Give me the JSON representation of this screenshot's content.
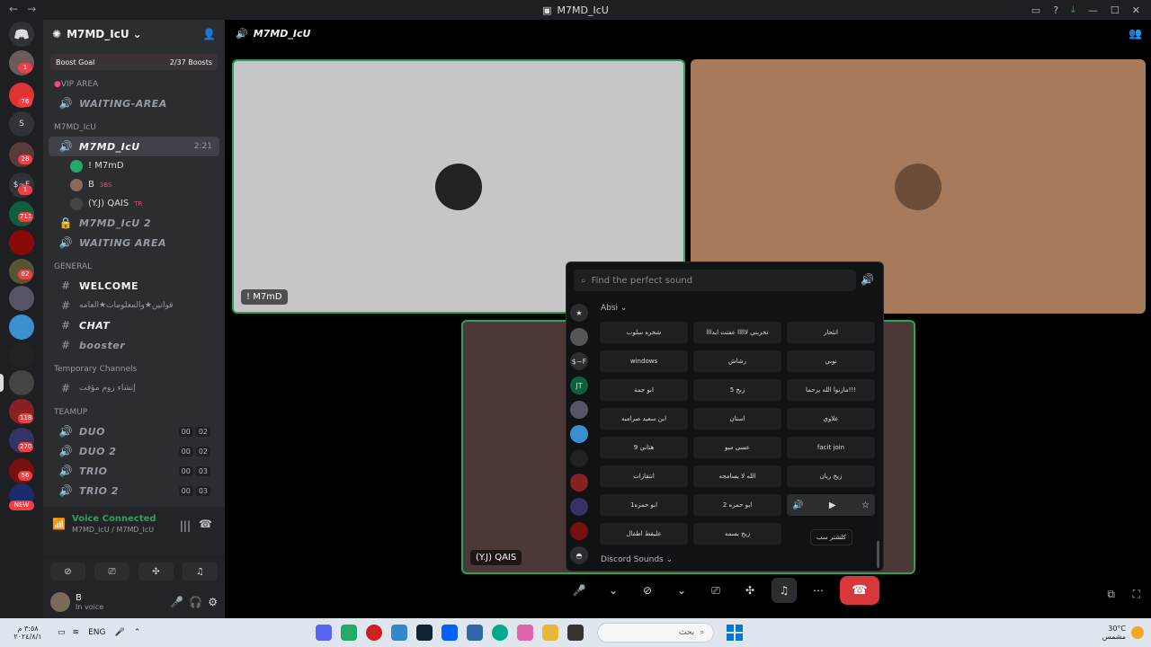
{
  "window": {
    "title": "M7MD_IcU"
  },
  "guild_badges": [
    "1",
    "76",
    "28",
    "1",
    "711",
    "62",
    "118",
    "270",
    "56",
    "NEW"
  ],
  "guild_labels": {
    "s": "S",
    "sf": "$~F"
  },
  "server": {
    "name": "M7MD_IcU",
    "boost_goal": "Boost Goal",
    "boost_count": "2/37 Boosts",
    "categories": {
      "vip": "VIP AREA",
      "m7md": "M7MD_IcU",
      "general": "GENERAL",
      "temp": "Temporary Channels",
      "teamup": "TEAMUP"
    },
    "channels": {
      "waiting1": "WAITING-AREA",
      "m7md_active": "M7MD_IcU",
      "m7md_time": "2:21",
      "m7md2": "M7MD_IcU 2",
      "waiting2": "WAITING AREA",
      "welcome": "WELCOME",
      "rules": "قوانين★والمعلومات★العامه",
      "chat": "CHAT",
      "booster": "booster",
      "create_room": "إنشاء روم مؤقت",
      "duo": "DUO",
      "duo2": "DUO 2",
      "trio": "TRIO",
      "trio2": "TRIO 2",
      "duo_cnt": [
        "00",
        "02"
      ],
      "duo2_cnt": [
        "00",
        "02"
      ],
      "trio_cnt": [
        "00",
        "03"
      ],
      "trio2_cnt": [
        "00",
        "03"
      ]
    },
    "voice_users": [
      "! M7mD",
      "B",
      "(Y.J) QAIS"
    ],
    "user_tags": [
      "3BS",
      "TR"
    ]
  },
  "voice": {
    "status": "Voice Connected",
    "location": "M7MD_IcU / M7MD_IcU"
  },
  "panel": {
    "name": "B",
    "status": "In voice"
  },
  "call": {
    "header": "M7MD_IcU",
    "tiles": [
      "! M7mD",
      "",
      "(Y.J) QAIS"
    ]
  },
  "soundboard": {
    "placeholder": "Find the perfect sound",
    "section": "Absi",
    "footer": "Discord Sounds",
    "rail_labels": [
      "$~F",
      "JT"
    ],
    "sounds": [
      "شخره سلوب",
      "تخربني لااااا عفتت ابدااا",
      "انثحار",
      "windows",
      "رشاش",
      "نوبي",
      "ابو جمة",
      "زبخ 5",
      "مازنوا الله يرحما!!!",
      "ابن سعيد صرامبه",
      "استان",
      "علاوي",
      "هتاني 9",
      "عسى ميو",
      "facit join",
      "انتقازات",
      "الله لا يسامحه",
      "زيخ ريان",
      "ابو حمزه1",
      "ابو حمزه 2",
      "",
      "عليقط اطفال",
      "زيخ بسمه",
      "كلشتر سب"
    ],
    "tooltip": "كلشتر سب"
  },
  "taskbar": {
    "time": "٣:٥٨ م",
    "date": "٢٠٢٤/٨/١",
    "lang": "ENG",
    "search": "بحث",
    "weather_temp": "30°C",
    "weather_desc": "مشمس"
  }
}
